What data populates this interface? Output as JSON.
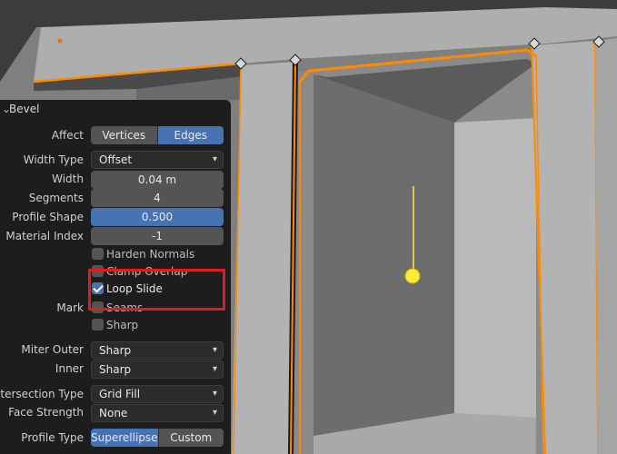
{
  "panel": {
    "title": "Bevel",
    "affect": {
      "label": "Affect",
      "options": [
        "Vertices",
        "Edges"
      ],
      "selected": "Edges"
    },
    "width_type": {
      "label": "Width Type",
      "value": "Offset"
    },
    "width": {
      "label": "Width",
      "value": "0.04 m"
    },
    "segments": {
      "label": "Segments",
      "value": "4"
    },
    "profile_shape": {
      "label": "Profile Shape",
      "value": "0.500"
    },
    "material_index": {
      "label": "Material Index",
      "value": "-1"
    },
    "harden_normals": {
      "label": "Harden Normals",
      "checked": false
    },
    "clamp_overlap": {
      "label": "Clamp Overlap",
      "checked": false
    },
    "loop_slide": {
      "label": "Loop Slide",
      "checked": true
    },
    "mark": {
      "label": "Mark",
      "seams": {
        "label": "Seams",
        "checked": false
      },
      "sharp": {
        "label": "Sharp",
        "checked": false
      }
    },
    "miter_outer": {
      "label": "Miter Outer",
      "value": "Sharp"
    },
    "inner": {
      "label": "Inner",
      "value": "Sharp"
    },
    "intersection_type": {
      "label": "Intersection Type",
      "value": "Grid Fill"
    },
    "face_strength": {
      "label": "Face Strength",
      "value": "None"
    },
    "profile_type": {
      "label": "Profile Type",
      "options": [
        "Superellipse",
        "Custom"
      ],
      "selected": "Superellipse"
    }
  },
  "colors": {
    "accent": "#4772b3",
    "selection_orange": "#ff8a00",
    "highlight_red": "#e11b22",
    "gizmo_yellow": "#ffea3a"
  }
}
